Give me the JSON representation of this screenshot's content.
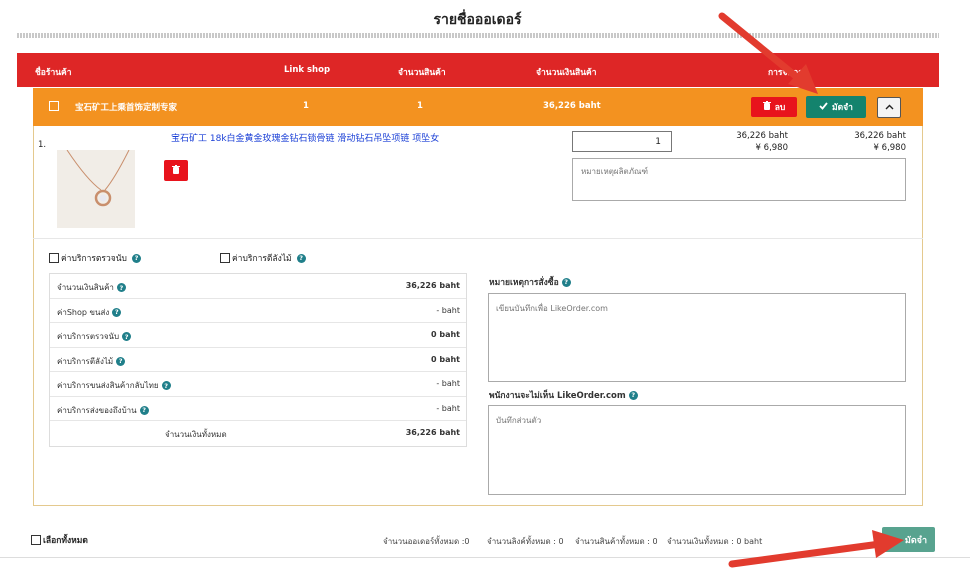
{
  "page": {
    "title": "รายชื่อออเดอร์"
  },
  "table_header": {
    "shop_name": "ชื่อร้านค้า",
    "link_shop": "Link shop",
    "quantity": "จำนวนสินค้า",
    "amount": "จำนวนเงินสินค้า",
    "manage": "การจัดการ"
  },
  "shop": {
    "name": "宝石矿工上乘首饰定制专家",
    "link_count": "1",
    "quantity": "1",
    "amount": "36,226 baht",
    "delete_label": "ลบ",
    "collect_label": "มัดจำ"
  },
  "item": {
    "index": "1.",
    "title": "宝石矿工 18k白金黄金玫瑰金钻石锁骨链 滑动钻石吊坠项链 项坠女",
    "quantity": "1",
    "note_placeholder": "หมายเหตุผลิตภัณฑ์",
    "unit_price_baht": "36,226 baht",
    "unit_price_yuan": "¥  6,980",
    "total_price_baht": "36,226 baht",
    "total_price_yuan": "¥  6,980"
  },
  "services": {
    "inspection": "ค่าบริการตรวจนับ",
    "crate": "ค่าบริการตีลังไม้"
  },
  "summary": {
    "rows": [
      {
        "label": "จำนวนเงินสินค้า",
        "value": "36,226 baht",
        "bold": true
      },
      {
        "label": "ค่าShop ขนส่ง",
        "value": "- baht",
        "bold": false
      },
      {
        "label": "ค่าบริการตรวจนับ",
        "value": "0 baht",
        "bold": true
      },
      {
        "label": "ค่าบริการตีลังไม้",
        "value": "0 baht",
        "bold": true
      },
      {
        "label": "ค่าบริการขนส่งสินค้ากลับไทย",
        "value": "- baht",
        "bold": false
      },
      {
        "label": "ค่าบริการส่งของถึงบ้าน",
        "value": "- baht",
        "bold": false
      }
    ],
    "total_label": "จำนวนเงินทั้งหมด",
    "total_value": "36,226 baht"
  },
  "order_remark": {
    "label": "หมายเหตุการสั่งซื้อ",
    "placeholder": "เขียนบันทึกเพื่อ LikeOrder.com"
  },
  "private_note": {
    "label": "พนักงานจะไม่เห็น LikeOrder.com",
    "placeholder": "บันทึกส่วนตัว"
  },
  "footer": {
    "select_all": "เลือกทั้งหมด",
    "total_orders": "จำนวนออเดอร์ทั้งหมด :0",
    "total_links": "จำนวนลิงค์ทั้งหมด : 0",
    "total_items": "จำนวนสินค้าทั้งหมด : 0",
    "total_amount": "จำนวนเงินทั้งหมด : 0 baht",
    "collect_label": "มัดจำ"
  },
  "colors": {
    "header_red": "#de2626",
    "shop_orange": "#f39220",
    "collect_green": "#14836d",
    "delete_red": "#e8131c",
    "arrow_red": "#e23b2e"
  },
  "icons": [
    "trash-icon",
    "check-icon",
    "chevron-up-icon",
    "help-icon",
    "arrow-pointer-icon"
  ]
}
